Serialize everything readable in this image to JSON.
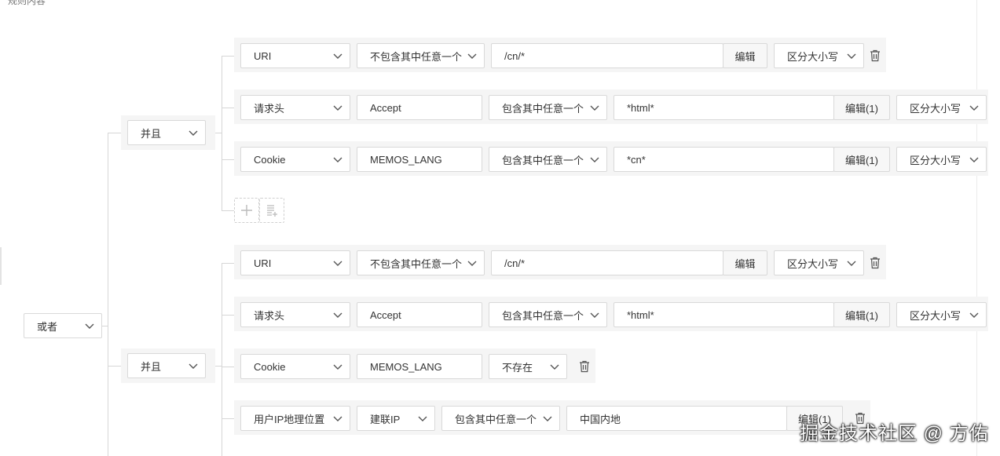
{
  "section_title": "规则内容",
  "root": {
    "logic": "或者"
  },
  "groups": [
    {
      "logic": "并且",
      "rows": [
        {
          "field": "URI",
          "operator": "不包含其中任意一个",
          "value": "/cn/*",
          "edit": "编辑",
          "case": "区分大小写"
        },
        {
          "field": "请求头",
          "key": "Accept",
          "operator": "包含其中任意一个",
          "value": "*html*",
          "edit": "编辑(1)",
          "case": "区分大小写"
        },
        {
          "field": "Cookie",
          "key": "MEMOS_LANG",
          "operator": "包含其中任意一个",
          "value": "*cn*",
          "edit": "编辑(1)",
          "case": "区分大小写"
        }
      ]
    },
    {
      "logic": "并且",
      "rows": [
        {
          "field": "URI",
          "operator": "不包含其中任意一个",
          "value": "/cn/*",
          "edit": "编辑",
          "case": "区分大小写"
        },
        {
          "field": "请求头",
          "key": "Accept",
          "operator": "包含其中任意一个",
          "value": "*html*",
          "edit": "编辑(1)",
          "case": "区分大小写"
        },
        {
          "field": "Cookie",
          "key": "MEMOS_LANG",
          "operator": "不存在"
        },
        {
          "field": "用户IP地理位置",
          "key": "建联IP",
          "operator": "包含其中任意一个",
          "value": "中国内地",
          "edit": "编辑(1)"
        }
      ]
    }
  ],
  "icons": {
    "chevron": "chevron-down-icon",
    "delete": "trash-icon",
    "add": "plus-icon",
    "add_group": "add-group-icon"
  },
  "watermark": "掘金技术社区 @ 方佑"
}
